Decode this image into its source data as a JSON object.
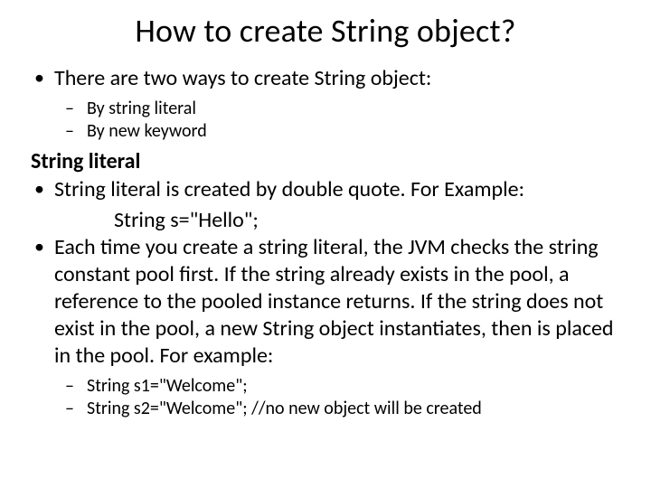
{
  "title": "How to create String object?",
  "bullets": {
    "intro": "There are two ways to create String object:",
    "ways": {
      "w1": "By string literal",
      "w2": "By new keyword"
    }
  },
  "section_heading": "String literal",
  "literal_point": "String literal is created by double quote. For Example:",
  "code_example": "String s=\"Hello\";",
  "pool_point": "Each time you create a string literal, the JVM checks the string constant pool first. If the string already exists in the pool, a reference to the pooled instance returns. If the string does not exist in the pool, a new String object instantiates, then is placed in the pool. For example:",
  "examples": {
    "e1": "String s1=\"Welcome\";",
    "e2": "String s2=\"Welcome\"; //no new object will be created"
  }
}
